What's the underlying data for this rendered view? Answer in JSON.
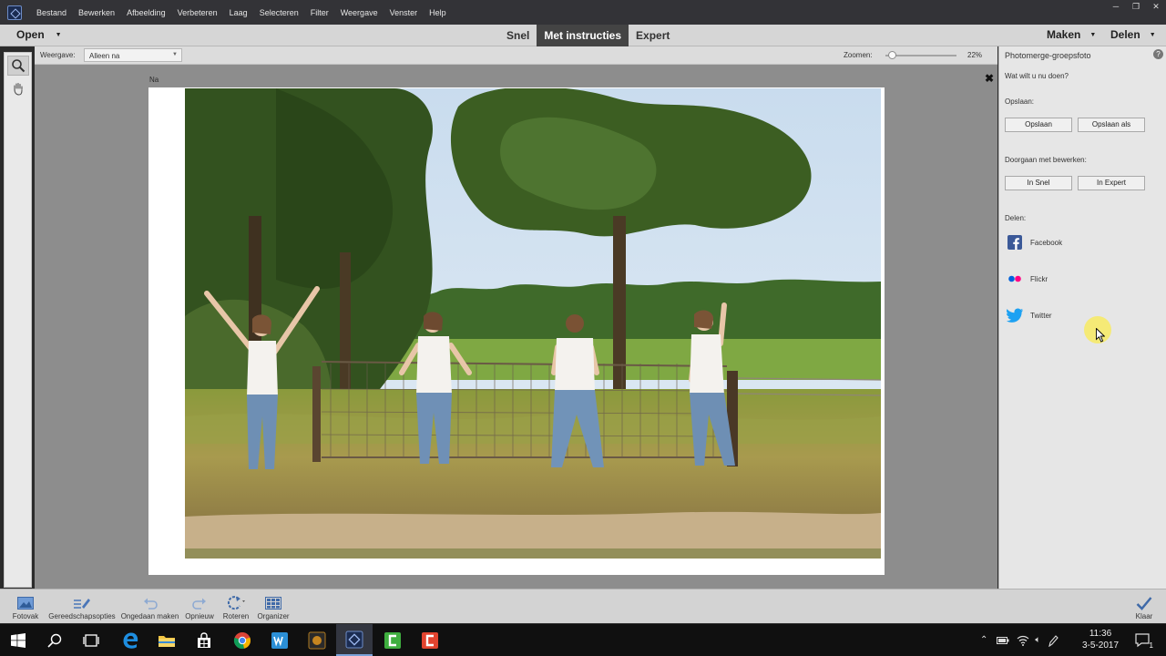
{
  "menu": {
    "items": [
      "Bestand",
      "Bewerken",
      "Afbeelding",
      "Verbeteren",
      "Laag",
      "Selecteren",
      "Filter",
      "Weergave",
      "Venster",
      "Help"
    ]
  },
  "window_controls": {
    "minimize": "─",
    "restore": "❐",
    "close": "✕"
  },
  "modebar": {
    "open_label": "Open",
    "tabs": [
      "Snel",
      "Met instructies",
      "Expert"
    ],
    "active_tab": "Met instructies",
    "make_label": "Maken",
    "share_label": "Delen"
  },
  "options": {
    "view_label": "Weergave:",
    "view_value": "Alleen na",
    "zoom_label": "Zoomen:",
    "zoom_value": "22%",
    "zoom_fraction": 0.05
  },
  "canvas": {
    "view_caption": "Na",
    "close_symbol": "✖"
  },
  "panel": {
    "title": "Photomerge-groepsfoto",
    "help": "?",
    "question": "Wat wilt u nu doen?",
    "save_heading": "Opslaan:",
    "save_button": "Opslaan",
    "save_as_button": "Opslaan als",
    "continue_heading": "Doorgaan met bewerken:",
    "quick_button": "In Snel",
    "expert_button": "In Expert",
    "share_heading": "Delen:",
    "share": [
      {
        "name": "Facebook",
        "icon": "facebook-icon",
        "color": "#3b5998"
      },
      {
        "name": "Flickr",
        "icon": "flickr-icon",
        "color": "#ff0084"
      },
      {
        "name": "Twitter",
        "icon": "twitter-icon",
        "color": "#1da1f2"
      }
    ]
  },
  "bottombar": {
    "photobin": "Fotovak",
    "tool_options": "Gereedschapsopties",
    "undo": "Ongedaan maken",
    "redo": "Opnieuw",
    "rotate": "Roteren",
    "organizer": "Organizer",
    "done": "Klaar"
  },
  "taskbar": {
    "time": "11:36",
    "date": "3-5-2017",
    "notifications": "1"
  }
}
